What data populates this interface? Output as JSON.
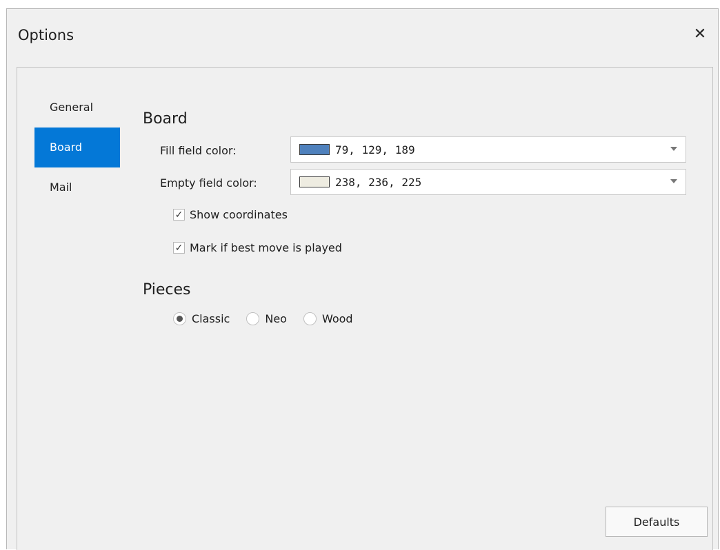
{
  "window": {
    "title": "Options"
  },
  "nav": {
    "items": [
      {
        "label": "General",
        "active": false
      },
      {
        "label": "Board",
        "active": true
      },
      {
        "label": "Mail",
        "active": false
      }
    ]
  },
  "board": {
    "title": "Board",
    "fill_label": "Fill field color:",
    "fill_value": "79, 129, 189",
    "fill_color": "#4f81bd",
    "empty_label": "Empty field color:",
    "empty_value": "238, 236, 225",
    "empty_color": "#eeece1",
    "show_coordinates_label": "Show coordinates",
    "show_coordinates_checked": true,
    "mark_best_move_label": "Mark if best move is played",
    "mark_best_move_checked": true
  },
  "pieces": {
    "title": "Pieces",
    "options": [
      "Classic",
      "Neo",
      "Wood"
    ],
    "selected": "Classic"
  },
  "footer": {
    "defaults_label": "Defaults"
  },
  "colors": {
    "accent": "#0478d7"
  }
}
